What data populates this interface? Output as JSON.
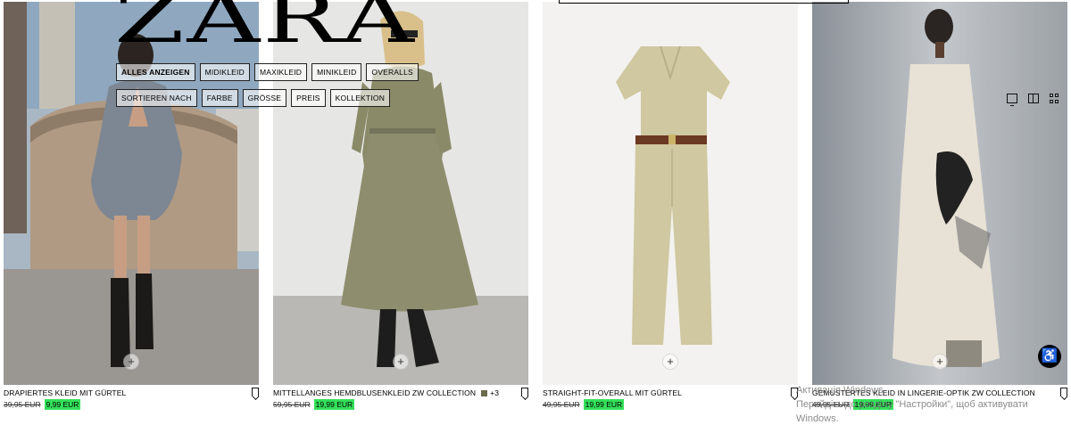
{
  "brand": {
    "logo_text": "ZARA"
  },
  "filters": {
    "row1": [
      {
        "label": "ALLES ANZEIGEN",
        "active": true
      },
      {
        "label": "MIDIKLEID",
        "active": false
      },
      {
        "label": "MAXIKLEID",
        "active": false
      },
      {
        "label": "MINIKLEID",
        "active": false
      },
      {
        "label": "OVERALLS",
        "active": false
      }
    ],
    "row2": [
      {
        "label": "SORTIEREN NACH"
      },
      {
        "label": "FARBE"
      },
      {
        "label": "GRÖSSE"
      },
      {
        "label": "PREIS"
      },
      {
        "label": "KOLLEKTION"
      }
    ]
  },
  "view_options": [
    "single-view-icon",
    "double-view-icon",
    "grid-view-icon"
  ],
  "products": [
    {
      "name": "DRAPIERTES KLEID MIT GÜRTEL",
      "old_price": "39,95 EUR",
      "new_price": "9,99 EUR",
      "extra": ""
    },
    {
      "name": "MITTELLANGES HEMDBLUSENKLEID ZW COLLECTION",
      "old_price": "59,95 EUR",
      "new_price": "19,99 EUR",
      "extra": "+3"
    },
    {
      "name": "STRAIGHT-FIT-OVERALL MIT GÜRTEL",
      "old_price": "49,95 EUR",
      "new_price": "19,99 EUR",
      "extra": ""
    },
    {
      "name": "GEMUSTERTES KLEID IN LINGERIE-OPTIK ZW COLLECTION",
      "old_price": "49,95 EUR",
      "new_price": "19,99 EUR",
      "extra": ""
    }
  ],
  "add_symbol": "+",
  "accessibility_symbol": "♿",
  "windows_watermark": {
    "line1": "Активація Windows",
    "line2": "Перейдіть до розділу \"Настройки\", щоб активувати",
    "line3": "Windows."
  },
  "colors": {
    "sale_highlight": "#33e05a",
    "text": "#000000"
  }
}
